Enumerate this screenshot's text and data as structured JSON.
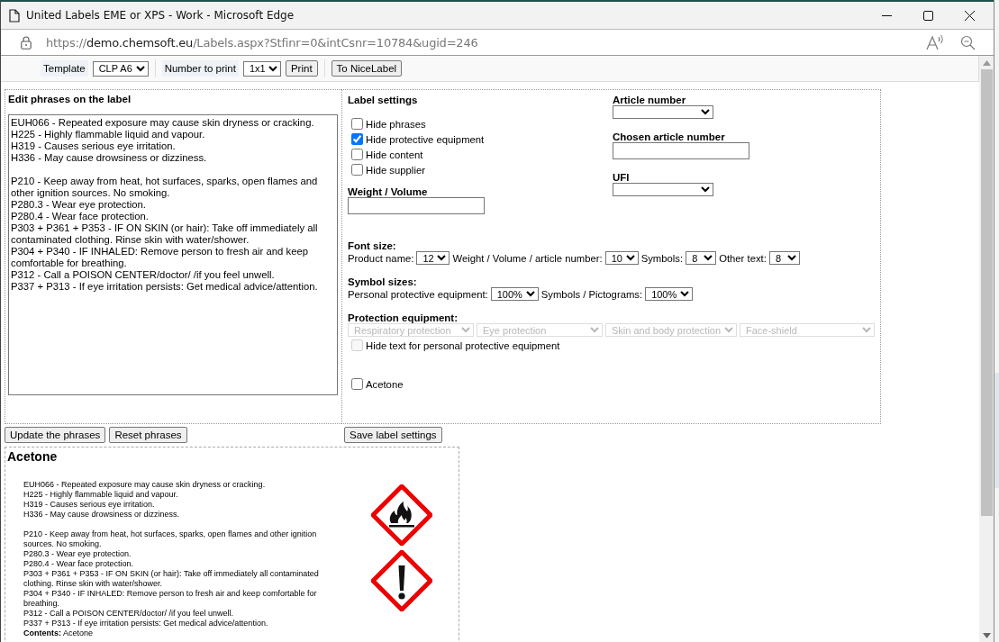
{
  "window": {
    "title": "United Labels EME or XPS - Work - Microsoft Edge"
  },
  "address_bar": {
    "url": "https://demo.chemsoft.eu/Labels.aspx?Stfinr=0&intCsnr=10784&ugid=246"
  },
  "toolbar": {
    "template": {
      "label": "Template",
      "value": "CLP A6"
    },
    "number_to_print": {
      "label": "Number to print",
      "value": "1x1"
    },
    "buttons": [
      "Print",
      "To NiceLabel"
    ]
  },
  "phrases_editor": {
    "title": "Edit phrases on the label",
    "groups": [
      [
        "EUH066 - Repeated exposure may cause skin dryness or cracking.",
        "H225 - Highly flammable liquid and vapour.",
        "H319 - Causes serious eye irritation.",
        "H336 - May cause drowsiness or dizziness."
      ],
      [
        "P210 - Keep away from heat, hot surfaces, sparks, open flames and other ignition sources. No smoking.",
        "P280.3 - Wear eye protection.",
        "P280.4 - Wear face protection.",
        "P303 + P361 + P353 - IF ON SKIN (or hair): Take off immediately all contaminated clothing. Rinse skin with water/shower.",
        "P304 + P340 - IF INHALED: Remove person to fresh air and keep comfortable for breathing.",
        "P312 - Call a POISON CENTER/doctor/ /if you feel unwell.",
        "P337 + P313 - If eye irritation persists: Get medical advice/attention."
      ]
    ],
    "buttons": [
      "Update the phrases",
      "Reset phrases"
    ]
  },
  "label_settings": {
    "title": "Label settings",
    "options": [
      {
        "label": "Hide phrases",
        "checked": false
      },
      {
        "label": "Hide protective equipment",
        "checked": true
      },
      {
        "label": "Hide content",
        "checked": false
      },
      {
        "label": "Hide supplier",
        "checked": false
      }
    ],
    "weight_volume": {
      "label": "Weight / Volume"
    },
    "article_number": {
      "label": "Article number"
    },
    "chosen_article_number": {
      "label": "Chosen article number"
    },
    "ufi": {
      "label": "UFI"
    },
    "font_size": {
      "title": "Font size:",
      "fields": [
        {
          "label": "Product name:",
          "value": "12"
        },
        {
          "label": "Weight / Volume / article number:",
          "value": "10"
        },
        {
          "label": "Symbols:",
          "value": "8"
        },
        {
          "label": "Other text:",
          "value": "8"
        }
      ]
    },
    "symbol_sizes": {
      "title": "Symbol sizes:",
      "fields": [
        {
          "label": "Personal protective equipment:",
          "value": "100%"
        },
        {
          "label": "Symbols / Pictograms:",
          "value": "100%"
        }
      ]
    },
    "protection_equipment": {
      "title": "Protection equipment:",
      "selects": [
        {
          "value": "Respiratory protection",
          "disabled": true
        },
        {
          "value": "Eye protection",
          "disabled": true
        },
        {
          "value": "Skin and body protection",
          "disabled": true
        },
        {
          "value": "Face-shield",
          "disabled": true
        }
      ],
      "hide_text": {
        "label": "Hide text for personal protective equipment",
        "checked": false,
        "disabled": true
      }
    },
    "substances": [
      {
        "label": "Acetone",
        "checked": false
      }
    ],
    "save_button": "Save label settings"
  },
  "label_preview": {
    "product_name": "Acetone",
    "groups": [
      [
        "EUH066 - Repeated exposure may cause skin dryness or cracking.",
        "H225 - Highly flammable liquid and vapour.",
        "H319 - Causes serious eye irritation.",
        "H336 - May cause drowsiness or dizziness."
      ],
      [
        "P210 - Keep away from heat, hot surfaces, sparks, open flames and other ignition sources. No smoking.",
        "P280.3 - Wear eye protection.",
        "P280.4 - Wear face protection.",
        "P303 + P361 + P353 - IF ON SKIN (or hair): Take off immediately all contaminated clothing. Rinse skin with water/shower.",
        "P304 + P340 - IF INHALED: Remove person to fresh air and keep comfortable for breathing.",
        "P312 - Call a POISON CENTER/doctor/ /if you feel unwell.",
        "P337 + P313 - If eye irritation persists: Get medical advice/attention."
      ]
    ],
    "contents": "**Contents:** Acetone",
    "pictograms": [
      {
        "kind": "flame"
      },
      {
        "kind": "exclamation"
      }
    ]
  }
}
